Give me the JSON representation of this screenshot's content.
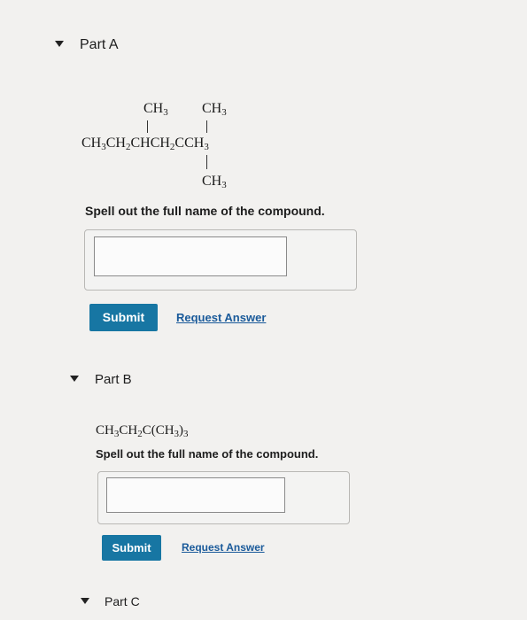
{
  "parts": [
    {
      "title": "Part A",
      "structure": {
        "top_left": [
          "CH",
          "3"
        ],
        "top_right": [
          "CH",
          "3"
        ],
        "main_chain": [
          [
            "CH",
            "3"
          ],
          [
            "CH",
            "2"
          ],
          [
            "CHCH",
            "2"
          ],
          [
            "CCH",
            "3"
          ]
        ],
        "bottom": [
          "CH",
          "3"
        ]
      },
      "prompt": "Spell out the full name of the compound.",
      "answer_value": "",
      "submit_label": "Submit",
      "request_label": "Request Answer"
    },
    {
      "title": "Part B",
      "formula": [
        [
          "CH",
          "3"
        ],
        [
          "CH",
          "2"
        ],
        [
          "C(CH",
          "3"
        ],
        [
          ")",
          "3"
        ]
      ],
      "prompt": "Spell out the full name of the compound.",
      "answer_value": "",
      "submit_label": "Submit",
      "request_label": "Request Answer"
    },
    {
      "title": "Part C"
    }
  ],
  "colors": {
    "submit_button": "#1776a3",
    "link": "#1a5a9a",
    "background": "#f2f1ef"
  },
  "icons": {
    "collapse": "caret-down-icon"
  }
}
